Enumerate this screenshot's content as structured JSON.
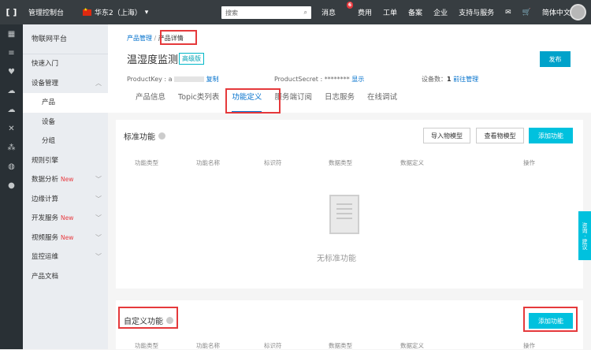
{
  "topbar": {
    "console": "管理控制台",
    "region": "华东2（上海）",
    "search_placeholder": "搜索",
    "nav": [
      "消息",
      "费用",
      "工单",
      "备案",
      "企业",
      "支持与服务"
    ],
    "msg_count": "6",
    "lang": "简体中文"
  },
  "sidenav": {
    "title": "物联网平台",
    "items": [
      {
        "label": "快速入门",
        "new": ""
      },
      {
        "label": "设备管理",
        "new": ""
      },
      {
        "label": "产品",
        "new": ""
      },
      {
        "label": "设备",
        "new": ""
      },
      {
        "label": "分组",
        "new": ""
      },
      {
        "label": "规则引擎",
        "new": ""
      },
      {
        "label": "数据分析",
        "new": "New"
      },
      {
        "label": "边缘计算",
        "new": ""
      },
      {
        "label": "开发服务",
        "new": "New"
      },
      {
        "label": "视频服务",
        "new": "New"
      },
      {
        "label": "监控运维",
        "new": ""
      },
      {
        "label": "产品文档",
        "new": ""
      }
    ]
  },
  "breadcrumb": {
    "root": "产品管理",
    "sep": "/",
    "current": "产品详情"
  },
  "product": {
    "title": "温湿度监测",
    "tag": "高级版",
    "publish": "发布",
    "key_label": "ProductKey :",
    "key_value": "a",
    "copy": "复制",
    "secret_label": "ProductSecret : ********",
    "show": "显示",
    "device_label": "设备数：",
    "device_count": "1",
    "goto": "前往管理"
  },
  "tabs": [
    "产品信息",
    "Topic类列表",
    "功能定义",
    "服务端订阅",
    "日志服务",
    "在线调试"
  ],
  "standard": {
    "title": "标准功能",
    "import": "导入物模型",
    "view": "查看物模型",
    "add": "添加功能",
    "empty": "无标准功能"
  },
  "table_headers": [
    "功能类型",
    "功能名称",
    "标识符",
    "数据类型",
    "数据定义",
    "操作"
  ],
  "custom": {
    "title": "自定义功能",
    "add": "添加功能"
  },
  "float_btn": "咨询 · 建议"
}
